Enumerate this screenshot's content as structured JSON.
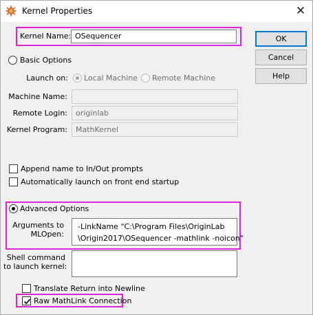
{
  "window": {
    "title": "Kernel Properties",
    "icon": "starburst-app-icon",
    "close_glyph": "✕"
  },
  "kernel_name": {
    "label": "Kernel Name:",
    "value": "OSequencer"
  },
  "buttons": {
    "ok": "OK",
    "cancel": "Cancel",
    "help": "Help"
  },
  "basic": {
    "label": "Basic Options",
    "launch_on_label": "Launch on:",
    "local_machine": "Local Machine",
    "remote_machine": "Remote Machine",
    "machine_name_label": "Machine Name:",
    "machine_name_value": "",
    "remote_login_label": "Remote Login:",
    "remote_login_value": "originlab",
    "kernel_program_label": "Kernel Program:",
    "kernel_program_value": "MathKernel"
  },
  "checkboxes": {
    "append_name": "Append name to In/Out prompts",
    "auto_launch": "Automatically launch on front end startup",
    "translate_return": "Translate Return into Newline",
    "raw_mathlink": "Raw MathLink Connection"
  },
  "advanced": {
    "label": "Advanced Options",
    "arguments_label_line1": "Arguments to",
    "arguments_label_line2": "MLOpen:",
    "arguments_line1": "-LinkName \"C:\\Program Files\\OriginLab",
    "arguments_line2": "\\Origin2017\\OSequencer -mathlink -noicon\"",
    "shell_label_line1": "Shell command",
    "shell_label_line2": "to launch kernel:",
    "shell_value": ""
  },
  "state": {
    "basic_selected": false,
    "advanced_selected": true,
    "local_machine_selected": true,
    "append_name_checked": false,
    "auto_launch_checked": false,
    "translate_return_checked": false,
    "raw_mathlink_checked": true
  },
  "colors": {
    "highlight": "#e020e0",
    "default_button_border": "#0078d7",
    "dialog_bg": "#f0f0f0"
  }
}
